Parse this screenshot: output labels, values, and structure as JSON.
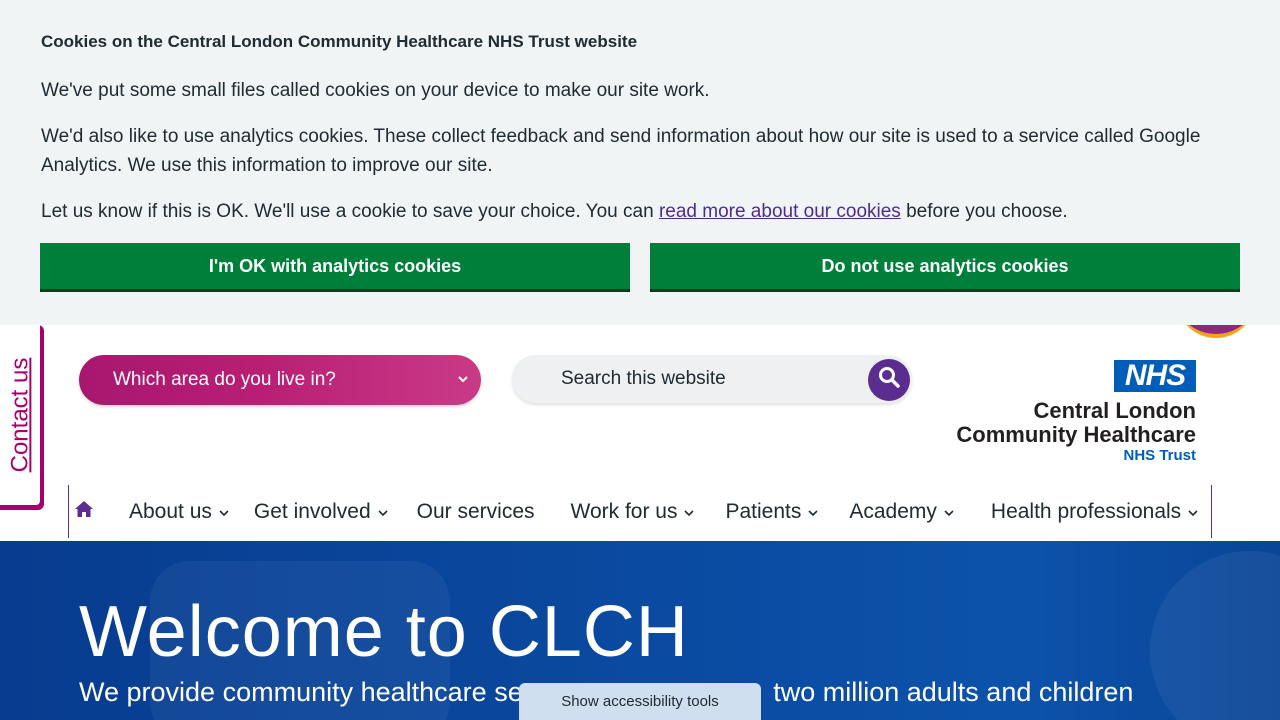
{
  "cookie_banner": {
    "title": "Cookies on the Central London Community Healthcare NHS Trust website",
    "p1": "We've put some small files called cookies on your device to make our site work.",
    "p2": "We'd also like to use analytics cookies. These collect feedback and send information about how our site is used to a service called Google Analytics. We use this information to improve our site.",
    "p3_before": "Let us know if this is OK. We'll use a cookie to save your choice. You can ",
    "p3_link": "read more about our cookies",
    "p3_after": " before you choose.",
    "accept_label": "I'm OK with analytics cookies",
    "reject_label": "Do not use analytics cookies"
  },
  "contact_tab": {
    "label": "Contact us"
  },
  "header": {
    "area_select": "Which area do you live in?",
    "search_placeholder": "Search this website"
  },
  "logo": {
    "badge": "NHS",
    "line1": "Central London",
    "line2": "Community Healthcare",
    "line3": "NHS Trust"
  },
  "nav": {
    "items": [
      {
        "label": "About us",
        "dropdown": true
      },
      {
        "label": "Get involved",
        "dropdown": true
      },
      {
        "label": "Our services",
        "dropdown": false
      },
      {
        "label": "Work for us",
        "dropdown": true
      },
      {
        "label": "Patients",
        "dropdown": true
      },
      {
        "label": "Academy",
        "dropdown": true
      },
      {
        "label": "Health professionals",
        "dropdown": true
      }
    ]
  },
  "hero": {
    "title": "Welcome to CLCH",
    "subtitle_left": "We provide community healthcare se",
    "subtitle_right": " two million adults and children"
  },
  "accessibility": {
    "label": "Show accessibility tools"
  },
  "colors": {
    "accent_green": "#007f3b",
    "brand_purple": "#5c2d91",
    "magenta": "#a5006e",
    "nhs_blue": "#005eb8",
    "hero_blue": "#0a4aa0"
  }
}
